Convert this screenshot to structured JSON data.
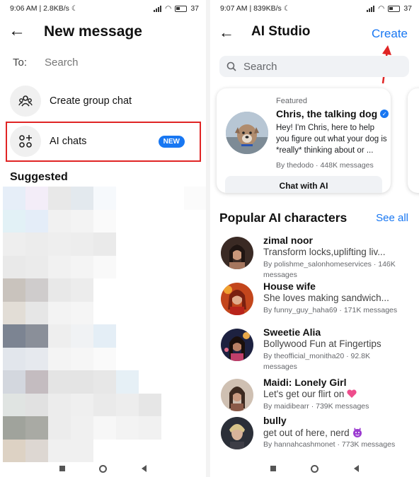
{
  "left": {
    "status": {
      "time": "9:06 AM",
      "speed": "2.8KB/s",
      "battery": "37"
    },
    "title": "New message",
    "to_label": "To:",
    "search_placeholder": "Search",
    "create_group_label": "Create group chat",
    "ai_chats_label": "AI chats",
    "new_badge": "NEW",
    "suggested_label": "Suggested"
  },
  "right": {
    "status": {
      "time": "9:07 AM",
      "speed": "839KB/s",
      "battery": "37"
    },
    "title": "AI Studio",
    "create_label": "Create",
    "search_placeholder": "Search",
    "featured_card": {
      "tag": "Featured",
      "name": "Chris, the talking dog",
      "description": "Hey! I'm Chris, here to help you figure out what your dog is *really* thinking about or ...",
      "by": "By thedodo · 448K messages",
      "button": "Chat with AI"
    },
    "popular_title": "Popular AI characters",
    "see_all": "See all",
    "characters": [
      {
        "name": "zimal noor",
        "description": "Transform locks,uplifting liv...",
        "meta": "By polishme_salonhomeservices · 146K messages"
      },
      {
        "name": "House wife",
        "description": "She loves making sandwich...",
        "meta": "By funny_guy_haha69 · 171K messages"
      },
      {
        "name": "Sweetie Alia",
        "description": "Bollywood Fun at Fingertips",
        "meta": "By theofficial_monitha20 · 92.8K messages"
      },
      {
        "name": "Maidi: Lonely Girl",
        "description": "Let's get our flirt on",
        "meta": "By maidibearr · 739K messages"
      },
      {
        "name": "bully",
        "description": "get out of here, nerd",
        "meta": "By hannahcashmonet · 773K messages"
      }
    ]
  },
  "colors": {
    "accent": "#1877f2",
    "highlight": "#e02424"
  }
}
